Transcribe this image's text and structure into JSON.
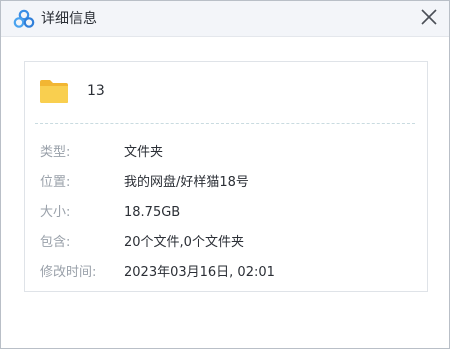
{
  "window": {
    "title": "详细信息",
    "app_icon": "baidu-netdisk-logo-icon",
    "close_icon": "close-icon"
  },
  "file": {
    "icon": "folder-icon",
    "name": "13"
  },
  "details": [
    {
      "label": "类型:",
      "value": "文件夹"
    },
    {
      "label": "位置:",
      "value": "我的网盘/好样猫18号"
    },
    {
      "label": "大小:",
      "value": "18.75GB"
    },
    {
      "label": "包含:",
      "value": "20个文件,0个文件夹"
    },
    {
      "label": "修改时间:",
      "value": "2023年03月16日, 02:01"
    }
  ],
  "colors": {
    "folder": "#f7c948",
    "logo_blue": "#3a8ee6"
  }
}
